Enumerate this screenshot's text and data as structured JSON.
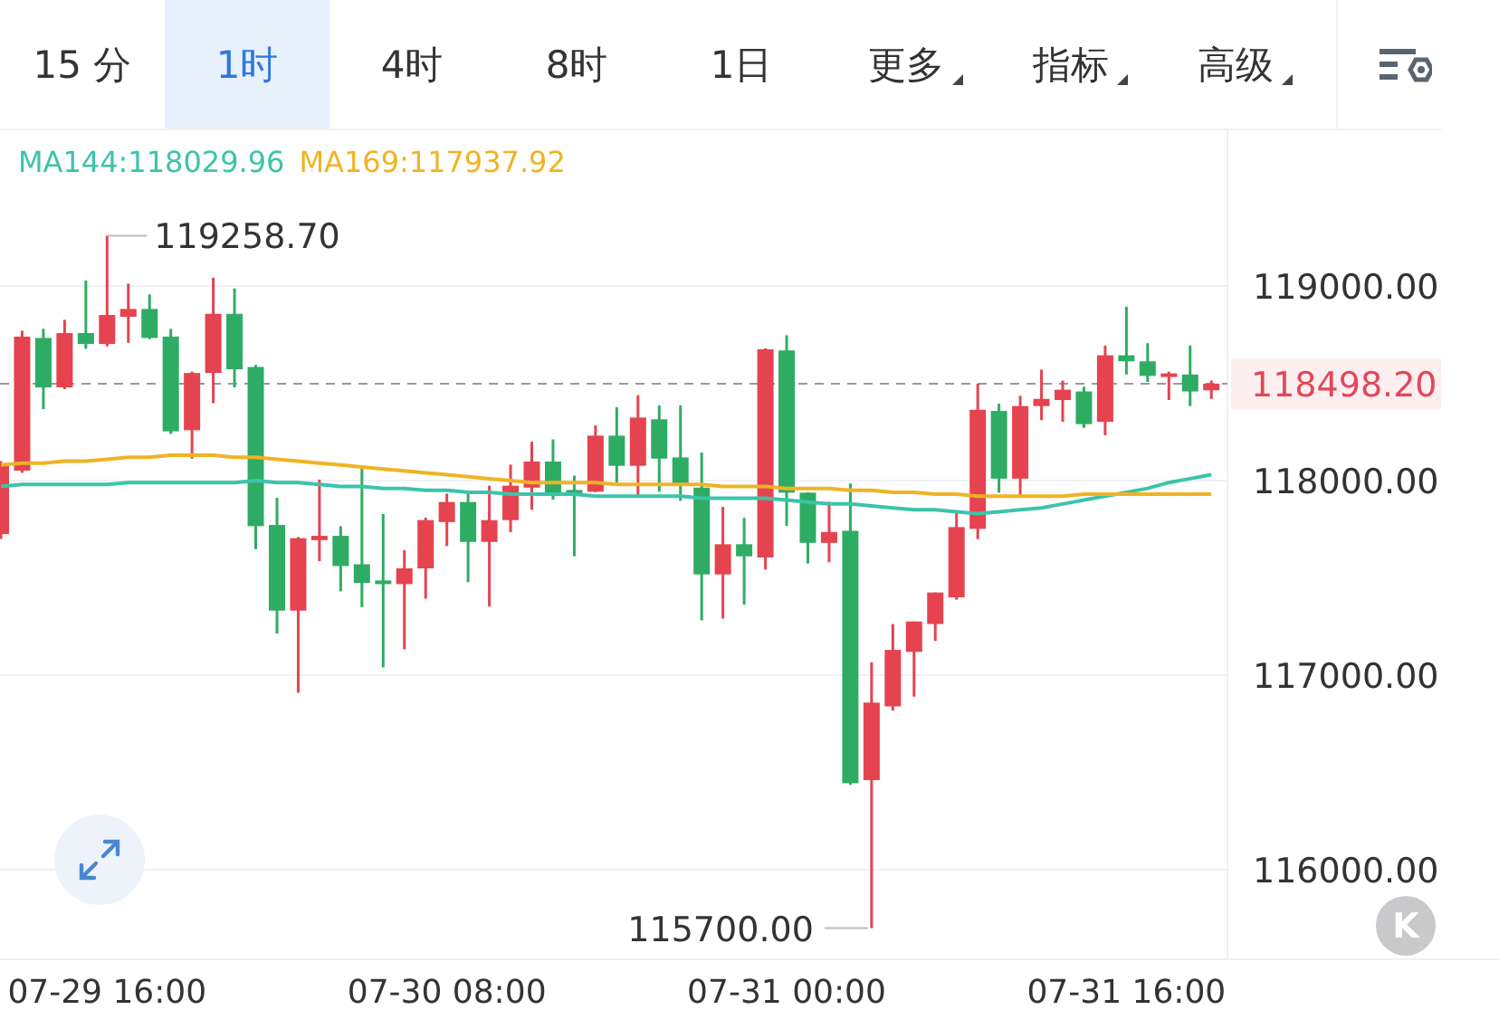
{
  "tabs": [
    {
      "label": "15 分",
      "selected": false,
      "dropdown": false
    },
    {
      "label": "1时",
      "selected": true,
      "dropdown": false
    },
    {
      "label": "4时",
      "selected": false,
      "dropdown": false
    },
    {
      "label": "8时",
      "selected": false,
      "dropdown": false
    },
    {
      "label": "1日",
      "selected": false,
      "dropdown": false
    },
    {
      "label": "更多",
      "selected": false,
      "dropdown": true
    },
    {
      "label": "指标",
      "selected": false,
      "dropdown": true
    },
    {
      "label": "高级",
      "selected": false,
      "dropdown": true
    }
  ],
  "chart": {
    "chart_data": {
      "type": "candlestick",
      "grid": true,
      "ylim": [
        115540,
        119800
      ],
      "categories": [
        null,
        null,
        null,
        null,
        null,
        "07-29 16:00",
        null,
        null,
        null,
        null,
        null,
        null,
        null,
        null,
        null,
        null,
        null,
        null,
        null,
        null,
        null,
        "07-30 08:00",
        null,
        null,
        null,
        null,
        null,
        null,
        null,
        null,
        null,
        null,
        null,
        null,
        null,
        null,
        null,
        "07-31 00:00",
        null,
        null,
        null,
        null,
        null,
        null,
        null,
        null,
        null,
        null,
        null,
        null,
        null,
        null,
        null,
        "07-31 16:00",
        null,
        null,
        null,
        null
      ],
      "yticks": [
        {
          "value": 116000,
          "label": "116000.00"
        },
        {
          "value": 117000,
          "label": "117000.00"
        },
        {
          "value": 118000,
          "label": "118000.00"
        },
        {
          "value": 119000,
          "label": "119000.00"
        }
      ],
      "series": [
        {
          "name": "MA144:118029.96",
          "type": "line",
          "color": "#3cc4aa",
          "values": [
            117970,
            117980,
            117980,
            117980,
            117980,
            117980,
            117990,
            117990,
            117990,
            117990,
            117990,
            117990,
            118000,
            117990,
            117990,
            117980,
            117970,
            117970,
            117960,
            117960,
            117950,
            117950,
            117940,
            117940,
            117930,
            117930,
            117930,
            117930,
            117920,
            117920,
            117920,
            117920,
            117920,
            117910,
            117910,
            117910,
            117910,
            117900,
            117890,
            117880,
            117880,
            117870,
            117860,
            117850,
            117850,
            117840,
            117830,
            117840,
            117850,
            117860,
            117880,
            117900,
            117920,
            117940,
            117960,
            117990,
            118010,
            118030
          ]
        },
        {
          "name": "MA169:117937.92",
          "type": "line",
          "color": "#f0b324",
          "values": [
            118080,
            118090,
            118090,
            118100,
            118100,
            118110,
            118120,
            118120,
            118130,
            118130,
            118130,
            118120,
            118120,
            118110,
            118100,
            118090,
            118080,
            118070,
            118060,
            118050,
            118040,
            118030,
            118020,
            118010,
            118000,
            117990,
            117990,
            117990,
            117990,
            117980,
            117980,
            117980,
            117980,
            117980,
            117970,
            117970,
            117970,
            117960,
            117960,
            117960,
            117950,
            117950,
            117940,
            117940,
            117930,
            117930,
            117920,
            117920,
            117920,
            117920,
            117920,
            117930,
            117930,
            117930,
            117930,
            117930,
            117930,
            117930
          ]
        }
      ],
      "ohlc": [
        [
          117725,
          118100,
          117700,
          118082
        ],
        [
          118051,
          118770,
          118040,
          118740
        ],
        [
          118733,
          118780,
          118367,
          118479
        ],
        [
          118479,
          118826,
          118470,
          118758
        ],
        [
          118758,
          119028,
          118677,
          118702
        ],
        [
          118702,
          119258.7,
          118690,
          118851
        ],
        [
          118842,
          119012,
          118708,
          118882
        ],
        [
          118882,
          118957,
          118727,
          118733
        ],
        [
          118740,
          118780,
          118240,
          118253
        ],
        [
          118259,
          118560,
          118113,
          118553
        ],
        [
          118553,
          119043,
          118398,
          118857
        ],
        [
          118857,
          118987,
          118479,
          118572
        ],
        [
          118584,
          118594,
          117648,
          117766
        ],
        [
          117772,
          117912,
          117214,
          117332
        ],
        [
          117332,
          117710,
          116910,
          117704
        ],
        [
          117694,
          118005,
          117586,
          117716
        ],
        [
          117716,
          117766,
          117431,
          117561
        ],
        [
          117570,
          118076,
          117350,
          117474
        ],
        [
          117487,
          117828,
          117040,
          117468
        ],
        [
          117468,
          117642,
          117133,
          117549
        ],
        [
          117549,
          117810,
          117393,
          117797
        ],
        [
          117787,
          117933,
          117664,
          117890
        ],
        [
          117890,
          117942,
          117478,
          117685
        ],
        [
          117685,
          117974,
          117353,
          117797
        ],
        [
          117797,
          118082,
          117735,
          117974
        ],
        [
          117964,
          118200,
          117850,
          118098
        ],
        [
          118098,
          118212,
          117902,
          117933
        ],
        [
          117952,
          118026,
          117611,
          117933
        ],
        [
          117943,
          118284,
          117940,
          118231
        ],
        [
          118231,
          118377,
          117989,
          118076
        ],
        [
          118076,
          118439,
          117911,
          118324
        ],
        [
          118315,
          118386,
          117943,
          118113
        ],
        [
          118119,
          118386,
          117896,
          117983
        ],
        [
          117964,
          118144,
          117282,
          117518
        ],
        [
          117518,
          117865,
          117291,
          117673
        ],
        [
          117673,
          117809,
          117363,
          117611
        ],
        [
          117605,
          118680,
          117543,
          118675
        ],
        [
          118669,
          118747,
          117767,
          117938
        ],
        [
          117938,
          117940,
          117574,
          117680
        ],
        [
          117680,
          117891,
          117580,
          117736
        ],
        [
          117742,
          117985,
          116436,
          116445
        ],
        [
          116461,
          117067,
          115700,
          116859
        ],
        [
          116840,
          117263,
          116818,
          117130
        ],
        [
          117120,
          117276,
          116890,
          117276
        ],
        [
          117263,
          117425,
          117176,
          117425
        ],
        [
          117400,
          117845,
          117388,
          117761
        ],
        [
          117752,
          118498,
          117699,
          118364
        ],
        [
          118358,
          118395,
          117938,
          118010
        ],
        [
          118010,
          118436,
          117916,
          118383
        ],
        [
          118383,
          118570,
          118311,
          118420
        ],
        [
          118414,
          118514,
          118302,
          118467
        ],
        [
          118458,
          118482,
          118271,
          118290
        ],
        [
          118302,
          118694,
          118233,
          118644
        ],
        [
          118644,
          118893,
          118545,
          118613
        ],
        [
          118613,
          118706,
          118507,
          118538
        ],
        [
          118538,
          118560,
          118414,
          118551
        ],
        [
          118545,
          118694,
          118383,
          118458
        ],
        [
          118464,
          118514,
          118420,
          118498.2
        ]
      ],
      "annotations": [
        "119258.70",
        "115700.00"
      ],
      "ref_lines": [
        {
          "axis": "y",
          "value": 118498.2,
          "label": "118498.20"
        }
      ]
    }
  },
  "k_button": {
    "label": "K"
  }
}
